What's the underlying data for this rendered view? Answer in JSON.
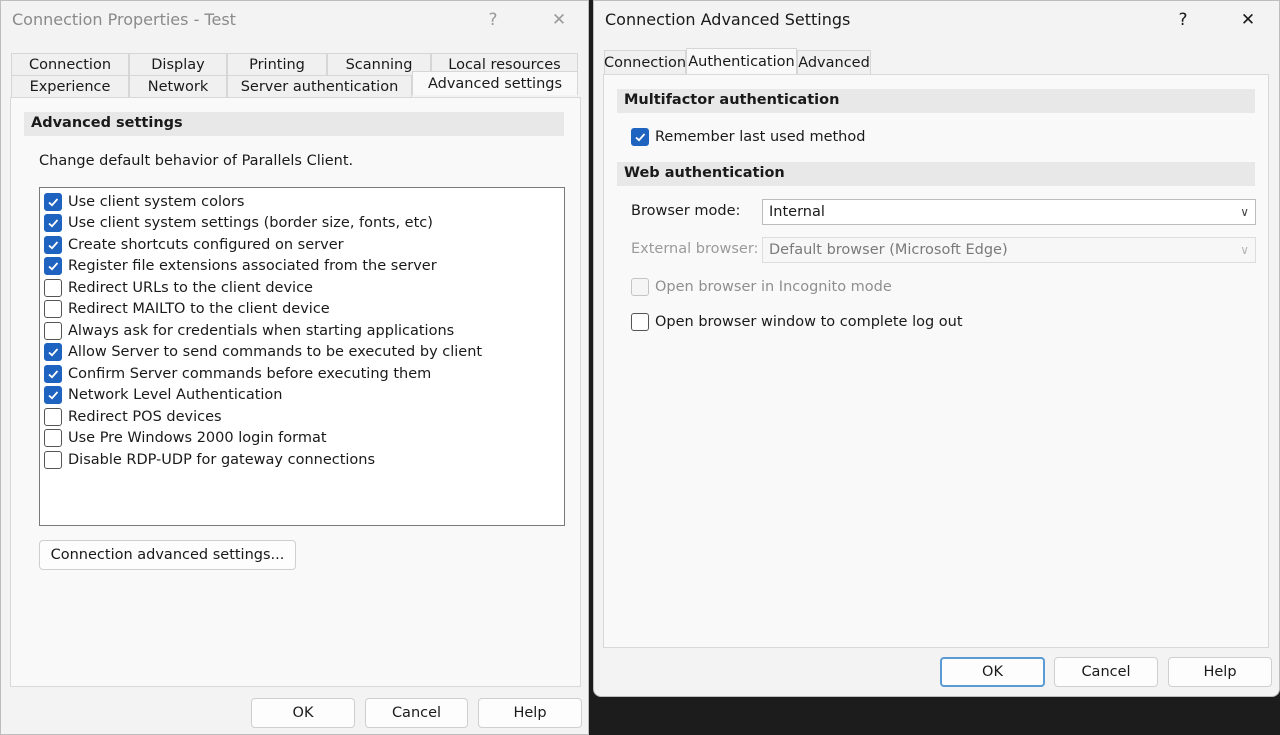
{
  "dialog1": {
    "title": "Connection Properties - Test",
    "help": "?",
    "close": "✕",
    "tabs_row1": [
      "Connection",
      "Display",
      "Printing",
      "Scanning",
      "Local resources"
    ],
    "tabs_row2": [
      "Experience",
      "Network",
      "Server authentication",
      "Advanced settings"
    ],
    "section": "Advanced settings",
    "description": "Change default behavior of Parallels Client.",
    "options": [
      {
        "label": "Use client system colors",
        "checked": true
      },
      {
        "label": "Use client system settings (border size, fonts, etc)",
        "checked": true
      },
      {
        "label": "Create shortcuts configured on server",
        "checked": true
      },
      {
        "label": "Register file extensions associated from the server",
        "checked": true
      },
      {
        "label": "Redirect URLs to the client device",
        "checked": false
      },
      {
        "label": "Redirect MAILTO to the client device",
        "checked": false
      },
      {
        "label": "Always ask for credentials when starting applications",
        "checked": false
      },
      {
        "label": "Allow Server to send commands to be executed by client",
        "checked": true
      },
      {
        "label": "Confirm Server commands before executing them",
        "checked": true
      },
      {
        "label": "Network Level Authentication",
        "checked": true
      },
      {
        "label": "Redirect POS devices",
        "checked": false
      },
      {
        "label": "Use Pre Windows 2000 login format",
        "checked": false
      },
      {
        "label": "Disable RDP-UDP for gateway connections",
        "checked": false
      }
    ],
    "advanced_button": "Connection advanced settings...",
    "ok": "OK",
    "cancel": "Cancel",
    "help_button": "Help"
  },
  "dialog2": {
    "title": "Connection Advanced Settings",
    "help": "?",
    "close": "✕",
    "tabs": [
      "Connection",
      "Authentication",
      "Advanced"
    ],
    "mfa_section": "Multifactor authentication",
    "remember_method": "Remember last used method",
    "web_section": "Web authentication",
    "browser_mode_label": "Browser mode:",
    "browser_mode_value": "Internal",
    "external_browser_label": "External browser:",
    "external_browser_value": "Default browser (Microsoft Edge)",
    "incognito": "Open browser in Incognito mode",
    "logout_window": "Open browser window to complete log out",
    "ok": "OK",
    "cancel": "Cancel",
    "help_button": "Help"
  },
  "colors": {
    "accent": "#1e63c0",
    "default_button_border": "#5b9bd5"
  }
}
